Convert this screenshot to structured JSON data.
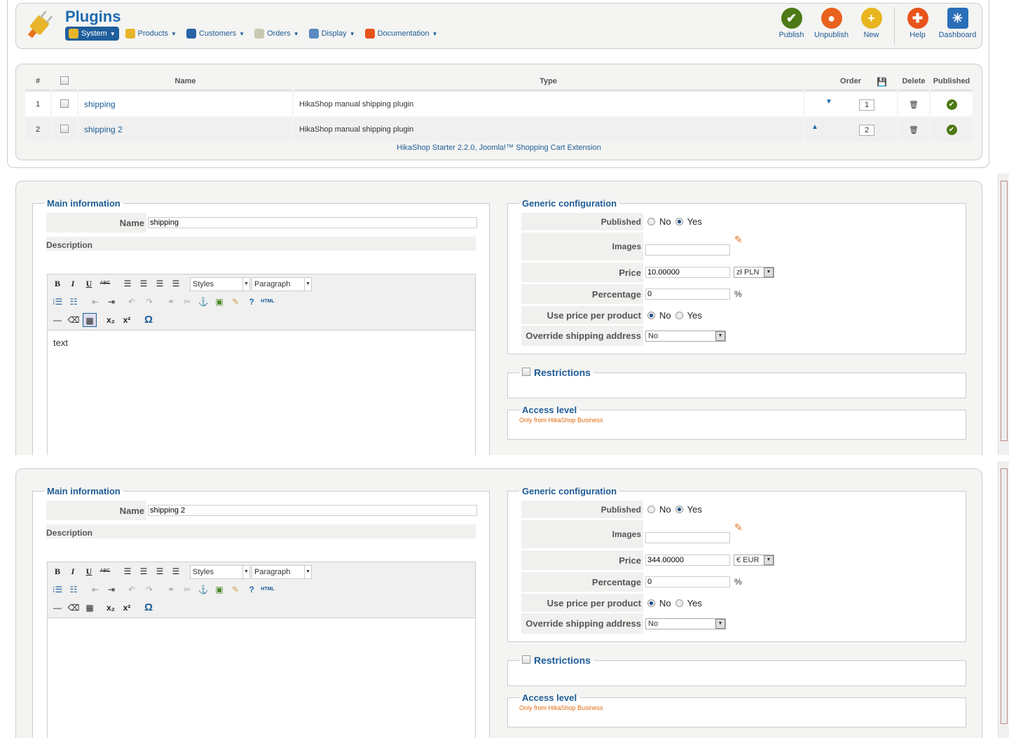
{
  "header": {
    "title": "Plugins",
    "menu": [
      {
        "label": "System",
        "color": "#e8b52a"
      },
      {
        "label": "Products",
        "color": "#e8b52a"
      },
      {
        "label": "Customers",
        "color": "#2a62a8"
      },
      {
        "label": "Orders",
        "color": "#c9c9b0"
      },
      {
        "label": "Display",
        "color": "#5a8ac0"
      },
      {
        "label": "Documentation",
        "color": "#e8541e"
      }
    ],
    "toolbar": [
      {
        "label": "Publish",
        "color": "#4d7a14",
        "glyph": "✔"
      },
      {
        "label": "Unpublish",
        "color": "#e8621e",
        "glyph": "●"
      },
      {
        "label": "New",
        "color": "#e8b51e",
        "glyph": "+"
      },
      {
        "label": "Help",
        "color": "#e8541e",
        "glyph": "✚"
      },
      {
        "label": "Dashboard",
        "color": "#2a6fb8",
        "glyph": "✳"
      }
    ]
  },
  "list": {
    "columns": {
      "num": "#",
      "name": "Name",
      "type": "Type",
      "order": "Order",
      "delete": "Delete",
      "published": "Published"
    },
    "rows": [
      {
        "num": "1",
        "name": "shipping",
        "type": "HikaShop manual shipping plugin",
        "order": "1",
        "arrow": "▼"
      },
      {
        "num": "2",
        "name": "shipping 2",
        "type": "HikaShop manual shipping plugin",
        "order": "2",
        "arrow": "▲"
      }
    ],
    "footer": "HikaShop Starter 2.2.0, Joomla!™ Shopping Cart Extension"
  },
  "labels": {
    "main_info": "Main information",
    "name": "Name",
    "description": "Description",
    "styles": "Styles",
    "paragraph": "Paragraph",
    "html": "HTML",
    "generic": "Generic configuration",
    "published": "Published",
    "no": "No",
    "yes": "Yes",
    "images": "Images",
    "price": "Price",
    "percentage": "Percentage",
    "percent_sign": "%",
    "use_price": "Use price per product",
    "override": "Override shipping address",
    "restrictions": "Restrictions",
    "access": "Access level",
    "access_note": "Only from HikaShop Business"
  },
  "forms": [
    {
      "name": "shipping",
      "description": "text",
      "price": "10.00000",
      "currency": "zł PLN",
      "percentage": "0",
      "override": "No",
      "published": "yes",
      "use_price": "no"
    },
    {
      "name": "shipping 2",
      "description": "",
      "price": "344.00000",
      "currency": "€ EUR",
      "percentage": "0",
      "override": "No",
      "published": "yes",
      "use_price": "no"
    }
  ]
}
